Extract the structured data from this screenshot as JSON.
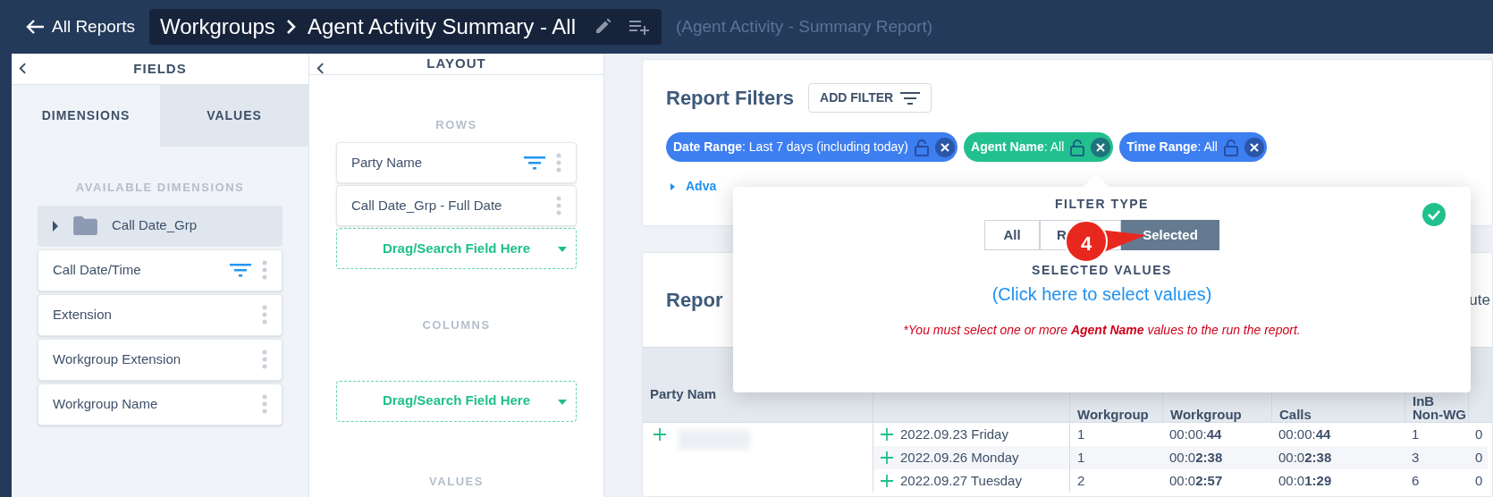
{
  "top_bar": {
    "back_label": "All Reports",
    "breadcrumb": [
      "Workgroups",
      "Agent Activity Summary - All"
    ],
    "subtitle": "(Agent Activity - Summary Report)"
  },
  "fields_panel": {
    "title": "FIELDS",
    "tabs": [
      {
        "label": "DIMENSIONS",
        "selected": true
      },
      {
        "label": "VALUES",
        "selected": false
      }
    ],
    "section": "AVAILABLE DIMENSIONS",
    "items": [
      {
        "kind": "folder",
        "label": "Call Date_Grp",
        "expanded": false
      },
      {
        "kind": "field",
        "label": "Call Date/Time",
        "filtered": true
      },
      {
        "kind": "field",
        "label": "Extension",
        "filtered": false
      },
      {
        "kind": "field",
        "label": "Workgroup Extension",
        "filtered": false
      },
      {
        "kind": "field",
        "label": "Workgroup Name",
        "filtered": false
      }
    ]
  },
  "layout_panel": {
    "title": "LAYOUT",
    "sections": [
      {
        "title": "ROWS",
        "items": [
          {
            "label": "Party Name",
            "filtered": true
          },
          {
            "label": "Call Date_Grp - Full Date",
            "filtered": false
          }
        ],
        "drop_placeholder": "Drag/Search Field Here"
      },
      {
        "title": "COLUMNS",
        "drop_placeholder": "Drag/Search Field Here"
      },
      {
        "title": "VALUES"
      }
    ]
  },
  "report_filters": {
    "title": "Report Filters",
    "add_button": "ADD FILTER",
    "chips": [
      {
        "text": "**Date Range**: Last 7 days (including today)",
        "color": "#3d7ef0"
      },
      {
        "text": "**Agent Name**: All",
        "color": "#22c08e"
      },
      {
        "text": "**Time Range**: All",
        "color": "#3d7ef0"
      }
    ],
    "advanced": "Adva"
  },
  "popup": {
    "title": "FILTER TYPE",
    "options": [
      {
        "label": "All",
        "selected": false
      },
      {
        "label": "R",
        "selected": false
      },
      {
        "label": "Selected",
        "selected": true
      }
    ],
    "values_title": "SELECTED VALUES",
    "link": "(Click here to select values)",
    "warning": "*You must select one or more **Agent Name** values to the run the report.",
    "callout": "4"
  },
  "report": {
    "title": "Repor",
    "right_text": "ute",
    "table": {
      "headers": {
        "column_1": "Party Nam",
        "column_3": "Workgroup",
        "column_4": "Workgroup",
        "column_5": "Calls",
        "column_6": "InB Non-WG"
      },
      "rows": [
        {
          "date": "2022.09.23 Friday",
          "column_3": "1",
          "column_4": "00:00:**44**",
          "column_5": "00:00:**44**",
          "column_6": "1",
          "column_7": "0"
        },
        {
          "date": "2022.09.26 Monday",
          "column_3": "1",
          "column_4": "00:0**2:38**",
          "column_5": "00:0**2:38**",
          "column_6": "3",
          "column_7": "0"
        },
        {
          "date": "2022.09.27 Tuesday",
          "column_3": "2",
          "column_4": "00:0**2:57**",
          "column_5": "00:0**1:29**",
          "column_6": "6",
          "column_7": "0"
        }
      ]
    }
  }
}
